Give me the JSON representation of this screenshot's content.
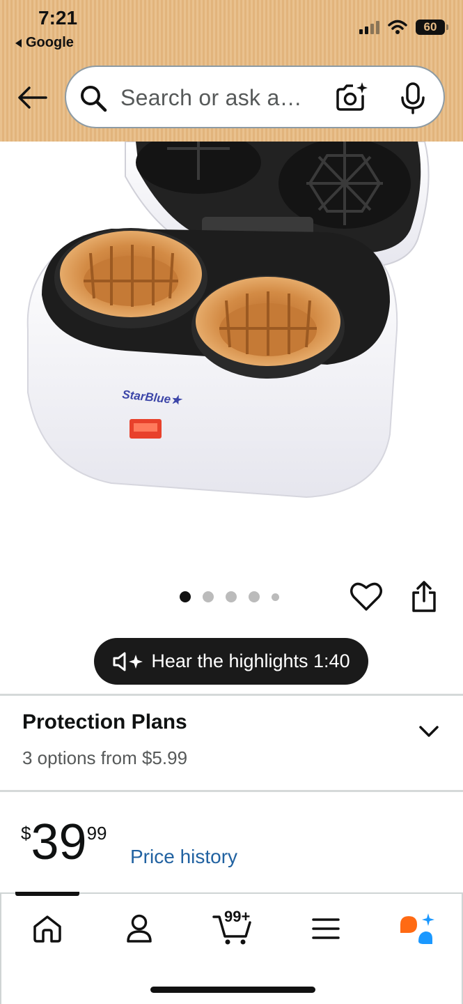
{
  "status_bar": {
    "time": "7:21",
    "back_app": "Google",
    "battery": "60"
  },
  "search": {
    "placeholder": "Search or ask a…",
    "icons": [
      "back-arrow-icon",
      "search-icon",
      "camera-sparkle-icon",
      "mic-icon"
    ]
  },
  "product_image": {
    "brand_logo": "StarBlue",
    "carousel_total": 5,
    "carousel_active": 1
  },
  "highlights": {
    "label": "Hear the highlights 1:40"
  },
  "protection": {
    "title": "Protection Plans",
    "subtitle": "3 options from $5.99"
  },
  "price": {
    "currency": "$",
    "whole": "39",
    "fraction": "99",
    "history_link": "Price history"
  },
  "bottom_nav": {
    "cart_count": "99+",
    "items": [
      "home-icon",
      "account-icon",
      "cart-icon",
      "menu-icon",
      "rufus-icon"
    ]
  },
  "colors": {
    "header_bg": "#e6bb85",
    "link": "#2162a1",
    "pill_bg": "#1a1a1a",
    "rufus_orange": "#ff6a13",
    "rufus_blue": "#1a98ff"
  }
}
